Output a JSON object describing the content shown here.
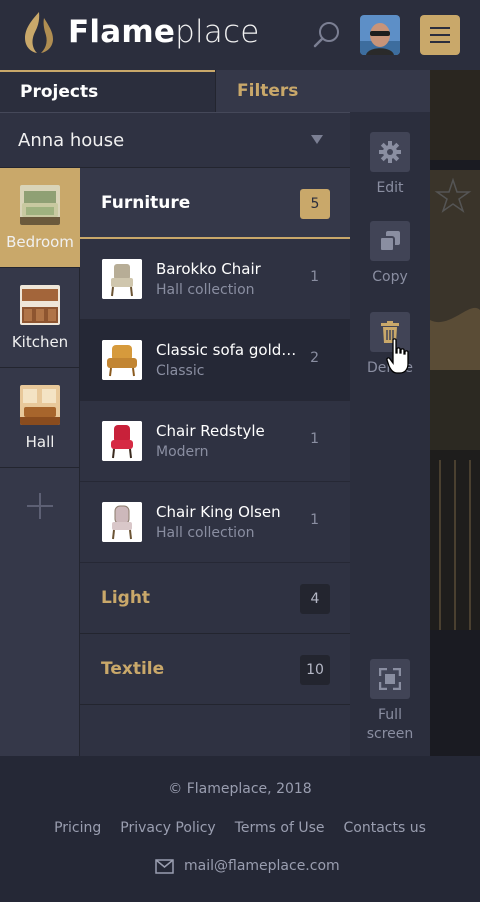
{
  "brand": {
    "bold": "Flame",
    "light": "place"
  },
  "tabs": {
    "projects": "Projects",
    "filters": "Filters"
  },
  "project": {
    "selected": "Anna house"
  },
  "rooms": [
    {
      "label": "Bedroom",
      "active": true
    },
    {
      "label": "Kitchen",
      "active": false
    },
    {
      "label": "Hall",
      "active": false
    }
  ],
  "categories": [
    {
      "name": "Furniture",
      "count": "5"
    },
    {
      "name": "Light",
      "count": "4"
    },
    {
      "name": "Textile",
      "count": "10"
    }
  ],
  "items": [
    {
      "name": "Barokko Chair",
      "sub": "Hall collection",
      "qty": "1"
    },
    {
      "name": "Classic sofa golde...",
      "sub": "Classic",
      "qty": "2"
    },
    {
      "name": "Chair Redstyle",
      "sub": "Modern",
      "qty": "1"
    },
    {
      "name": "Chair King Olsen",
      "sub": "Hall collection",
      "qty": "1"
    }
  ],
  "actions": {
    "edit": "Edit",
    "copy": "Copy",
    "delete": "Delete",
    "fullscreen": "Full screen"
  },
  "footer": {
    "copyright": "© Flameplace, 2018",
    "links": [
      "Pricing",
      "Privacy Policy",
      "Terms of Use",
      "Contacts us"
    ],
    "email": "mail@flameplace.com"
  },
  "colors": {
    "accent": "#c9a86a",
    "header": "#2b2e3d",
    "panel": "#2f3242"
  },
  "icons": [
    "flame-logo-icon",
    "search-icon",
    "menu-icon",
    "gear-icon",
    "copy-icon",
    "trash-icon",
    "fullscreen-icon",
    "plus-icon",
    "mail-icon",
    "hand-cursor-icon"
  ]
}
